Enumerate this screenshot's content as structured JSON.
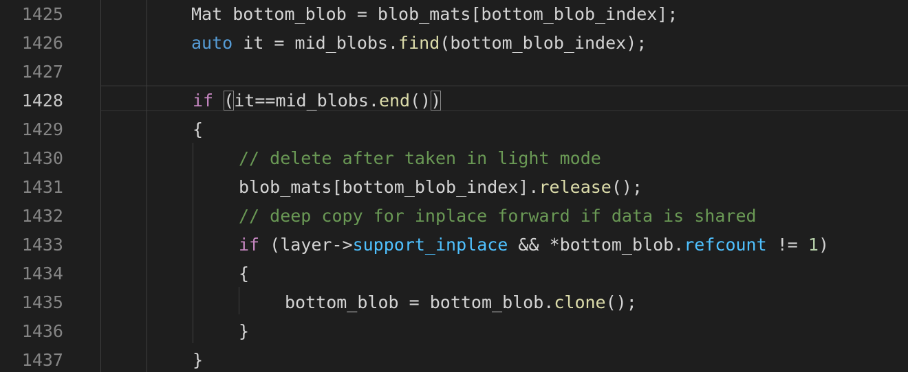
{
  "editor": {
    "line_numbers": [
      "1425",
      "1426",
      "1427",
      "1428",
      "1429",
      "1430",
      "1431",
      "1432",
      "1433",
      "1434",
      "1435",
      "1436",
      "1437"
    ],
    "active_line": "1428",
    "lines": [
      [
        {
          "t": "Mat bottom_blob = blob_mats[bottom_blob_index];",
          "c": "plain"
        }
      ],
      [
        {
          "t": "auto",
          "c": "type"
        },
        {
          "t": " it = mid_blobs.",
          "c": "plain"
        },
        {
          "t": "find",
          "c": "fn"
        },
        {
          "t": "(bottom_blob_index);",
          "c": "plain"
        }
      ],
      [],
      [
        {
          "t": "if",
          "c": "kw"
        },
        {
          "t": " ",
          "c": "plain"
        },
        {
          "t": "(",
          "c": "plain",
          "m": true
        },
        {
          "t": "it==mid_blobs.",
          "c": "plain"
        },
        {
          "t": "end",
          "c": "fn"
        },
        {
          "t": "()",
          "c": "plain"
        },
        {
          "t": ")",
          "c": "plain",
          "m": true
        }
      ],
      [
        {
          "t": "{",
          "c": "plain"
        }
      ],
      [
        {
          "t": "// delete after taken in light mode",
          "c": "comment"
        }
      ],
      [
        {
          "t": "blob_mats[bottom_blob_index].",
          "c": "plain"
        },
        {
          "t": "release",
          "c": "fn"
        },
        {
          "t": "();",
          "c": "plain"
        }
      ],
      [
        {
          "t": "// deep copy for inplace forward if data is shared",
          "c": "comment"
        }
      ],
      [
        {
          "t": "if",
          "c": "kw"
        },
        {
          "t": " (layer->",
          "c": "plain"
        },
        {
          "t": "support_inplace",
          "c": "prop"
        },
        {
          "t": " && *bottom_blob.",
          "c": "plain"
        },
        {
          "t": "refcount",
          "c": "prop"
        },
        {
          "t": " != ",
          "c": "plain"
        },
        {
          "t": "1",
          "c": "num"
        },
        {
          "t": ")",
          "c": "plain"
        }
      ],
      [
        {
          "t": "{",
          "c": "plain"
        }
      ],
      [
        {
          "t": "bottom_blob = bottom_blob.",
          "c": "plain"
        },
        {
          "t": "clone",
          "c": "fn"
        },
        {
          "t": "();",
          "c": "plain"
        }
      ],
      [
        {
          "t": "}",
          "c": "plain"
        }
      ],
      [
        {
          "t": "}",
          "c": "plain"
        }
      ]
    ],
    "colors": {
      "background": "#1e1e1e",
      "line_number": "#858585",
      "active_line_number": "#c6c6c6",
      "keyword": "#c586c0",
      "type": "#569cd6",
      "function": "#dcdcaa",
      "property": "#4fc1ff",
      "number": "#b5cea8",
      "comment": "#6a9955",
      "text": "#d4d4d4"
    }
  }
}
